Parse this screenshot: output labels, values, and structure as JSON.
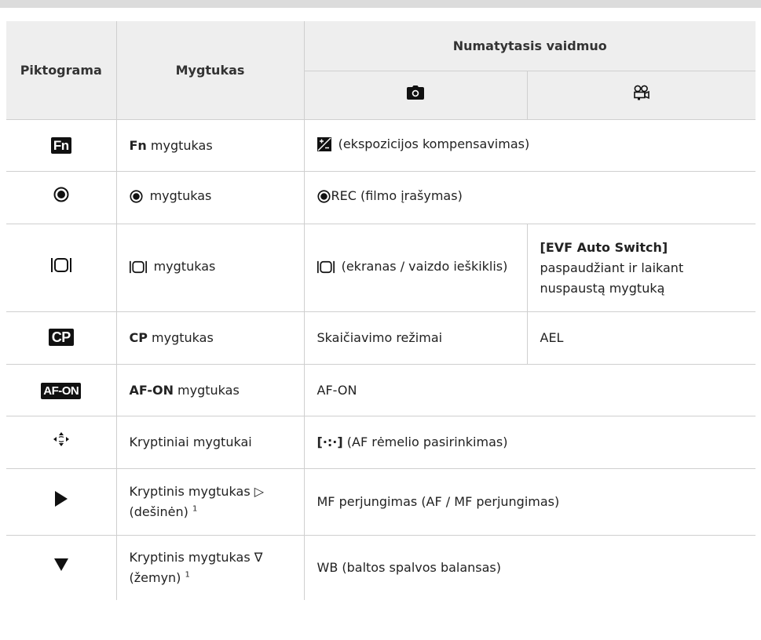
{
  "header": {
    "piktograma": "Piktograma",
    "mygtukas": "Mygtukas",
    "numatytasis": "Numatytasis vaidmuo",
    "camera_icon": "camera-icon",
    "movie_icon": "movie-camera-icon"
  },
  "rows": [
    {
      "icon": "Fn",
      "button_bold": "Fn",
      "button_rest": " mygtukas",
      "default_text": " (ekspozicijos kompensavimas)"
    },
    {
      "icon": "record-icon",
      "button_rest": " mygtukas",
      "default_text": "REC (filmo įrašymas)"
    },
    {
      "icon": "lv-icon",
      "button_rest": " mygtukas",
      "photo_text": " (ekranas / vaizdo ieškiklis)",
      "movie_bold": "[EVF Auto Switch]",
      "movie_rest": "paspaudžiant ir laikant nuspaustą mygtuką"
    },
    {
      "icon": "CP",
      "button_bold": "CP",
      "button_rest": " mygtukas",
      "photo_text": "Skaičiavimo režimai",
      "movie_text": "AEL"
    },
    {
      "icon": "AF-ON",
      "button_bold": "AF-ON",
      "button_rest": " mygtukas",
      "default_text": "AF-ON"
    },
    {
      "icon": "arrow-pad-icon",
      "button_text": "Kryptiniai mygtukai",
      "default_glyph": "[·:·]",
      "default_text": " (AF rėmelio pasirinkimas)"
    },
    {
      "icon": "play-right-icon",
      "button_text": "Kryptinis mygtukas ",
      "button_symbol": "▷",
      "button_sub": "(dešinėn) ",
      "sup": "1",
      "default_text": "MF perjungimas (AF / MF perjungimas)"
    },
    {
      "icon": "triangle-down-icon",
      "button_text": "Kryptinis mygtukas ",
      "button_symbol": "∇",
      "button_sub": "(žemyn) ",
      "sup": "1",
      "default_text": "WB (baltos spalvos balansas)"
    }
  ]
}
